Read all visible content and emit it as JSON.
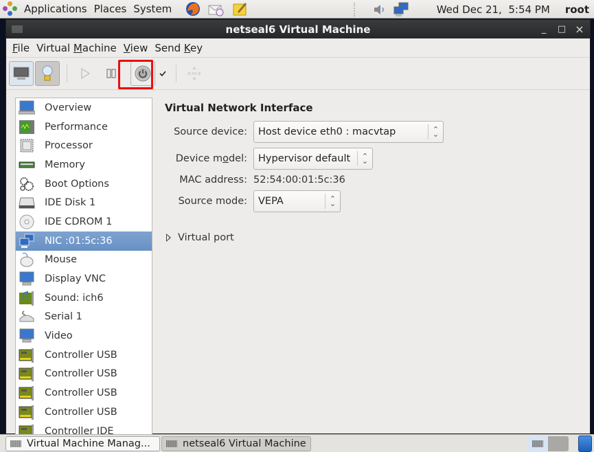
{
  "top_panel": {
    "menus": [
      "Applications",
      "Places",
      "System"
    ],
    "launchers": [
      "firefox-icon",
      "mail-icon",
      "notes-icon"
    ],
    "tray": [
      "volume-icon",
      "network-icon"
    ],
    "clock": "Wed Dec 21,  5:54 PM",
    "user": "root"
  },
  "window": {
    "title": "netseal6 Virtual Machine",
    "controls": {
      "minimize": "_",
      "maximize": "□",
      "close": "×"
    }
  },
  "menubar": {
    "items": [
      {
        "label": "File",
        "mnemonic": "F"
      },
      {
        "label": "Virtual Machine",
        "mnemonic": "M"
      },
      {
        "label": "View",
        "mnemonic": "V"
      },
      {
        "label": "Send Key",
        "mnemonic": "K"
      }
    ]
  },
  "toolbar": {
    "buttons": [
      "console-view",
      "details-view",
      "run",
      "pause",
      "shutdown",
      "shutdown-menu",
      "fullscreen"
    ],
    "highlighted": "shutdown",
    "highlight_color": "#e80f0f"
  },
  "hardware_list": {
    "selected_index": 7,
    "selection_color": "#6f97c9",
    "items": [
      {
        "label": "Overview",
        "icon": "monitor-icon"
      },
      {
        "label": "Performance",
        "icon": "performance-icon"
      },
      {
        "label": "Processor",
        "icon": "cpu-icon"
      },
      {
        "label": "Memory",
        "icon": "memory-icon"
      },
      {
        "label": "Boot Options",
        "icon": "gears-icon"
      },
      {
        "label": "IDE Disk 1",
        "icon": "disk-icon"
      },
      {
        "label": "IDE CDROM 1",
        "icon": "cdrom-icon"
      },
      {
        "label": "NIC :01:5c:36",
        "icon": "network-icon"
      },
      {
        "label": "Mouse",
        "icon": "mouse-icon"
      },
      {
        "label": "Display VNC",
        "icon": "display-icon"
      },
      {
        "label": "Sound: ich6",
        "icon": "sound-card-icon"
      },
      {
        "label": "Serial 1",
        "icon": "serial-icon"
      },
      {
        "label": "Video",
        "icon": "video-icon"
      },
      {
        "label": "Controller USB",
        "icon": "pci-card-icon"
      },
      {
        "label": "Controller USB",
        "icon": "pci-card-icon"
      },
      {
        "label": "Controller USB",
        "icon": "pci-card-icon"
      },
      {
        "label": "Controller USB",
        "icon": "pci-card-icon"
      },
      {
        "label": "Controller IDE",
        "icon": "pci-card-icon"
      }
    ]
  },
  "details": {
    "title": "Virtual Network Interface",
    "source_device": {
      "label": "Source device:",
      "value": "Host device eth0 : macvtap"
    },
    "device_model": {
      "label": "Device model:",
      "value": "Hypervisor default"
    },
    "mac_address": {
      "label": "MAC address:",
      "value": "52:54:00:01:5c:36"
    },
    "source_mode": {
      "label": "Source mode:",
      "value": "VEPA"
    },
    "virtual_port": {
      "label": "Virtual port",
      "expanded": false
    }
  },
  "taskbar": {
    "tasks": [
      "Virtual Machine Manag...",
      "netseal6 Virtual Machine"
    ],
    "active_task": 1
  }
}
